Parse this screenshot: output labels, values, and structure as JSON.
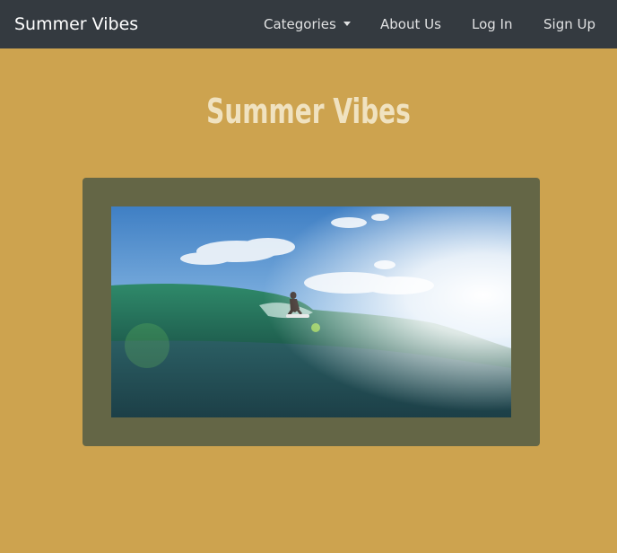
{
  "navbar": {
    "brand": "Summer Vibes",
    "items": [
      {
        "label": "Categories",
        "has_dropdown": true
      },
      {
        "label": "About Us"
      },
      {
        "label": "Log In"
      },
      {
        "label": "Sign Up"
      }
    ]
  },
  "main": {
    "title": "Summer Vibes",
    "image": {
      "subject": "surfer-riding-wave-photo"
    }
  },
  "colors": {
    "background": "#cda34f",
    "navbar": "#343a40",
    "title": "#f0e2c0",
    "frame": "#646646"
  }
}
